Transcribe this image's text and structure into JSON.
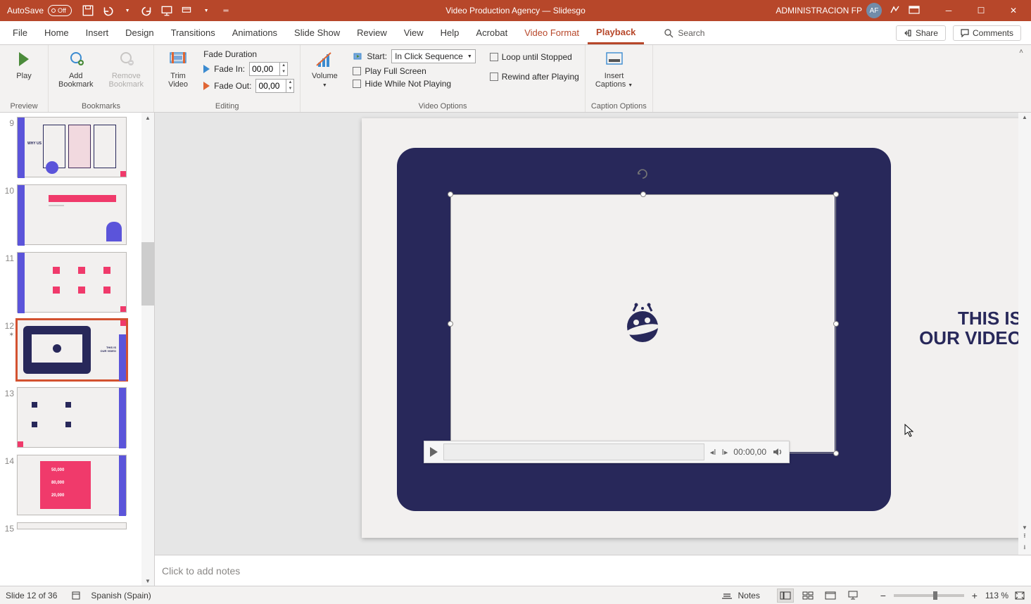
{
  "titlebar": {
    "autosave_label": "AutoSave",
    "autosave_state": "Off",
    "doc_title": "Video Production Agency — Slidesgo",
    "user_name": "ADMINISTRACION FP",
    "user_initials": "AF"
  },
  "tabs": {
    "file": "File",
    "home": "Home",
    "insert": "Insert",
    "design": "Design",
    "transitions": "Transitions",
    "animations": "Animations",
    "slideshow": "Slide Show",
    "review": "Review",
    "view": "View",
    "help": "Help",
    "acrobat": "Acrobat",
    "video_format": "Video Format",
    "playback": "Playback",
    "search": "Search",
    "share": "Share",
    "comments": "Comments"
  },
  "ribbon": {
    "preview": {
      "play": "Play",
      "group": "Preview"
    },
    "bookmarks": {
      "add": "Add\nBookmark",
      "remove": "Remove\nBookmark",
      "group": "Bookmarks"
    },
    "editing": {
      "trim": "Trim\nVideo",
      "fade_duration": "Fade Duration",
      "fade_in_label": "Fade In:",
      "fade_in_value": "00,00",
      "fade_out_label": "Fade Out:",
      "fade_out_value": "00,00",
      "group": "Editing"
    },
    "video_options": {
      "volume": "Volume",
      "start_label": "Start:",
      "start_value": "In Click Sequence",
      "play_fullscreen": "Play Full Screen",
      "hide_not_playing": "Hide While Not Playing",
      "loop": "Loop until Stopped",
      "rewind": "Rewind after Playing",
      "group": "Video Options"
    },
    "caption_options": {
      "insert_captions": "Insert\nCaptions",
      "group": "Caption Options"
    }
  },
  "thumbs": {
    "numbers": [
      "9",
      "10",
      "11",
      "12",
      "13",
      "14",
      "15"
    ],
    "active_index": 3
  },
  "slide": {
    "title_line1": "THIS IS",
    "title_line2": "OUR VIDEO",
    "video_time": "00:00,00"
  },
  "notes": {
    "placeholder": "Click to add notes"
  },
  "status": {
    "slide_info": "Slide 12 of 36",
    "language": "Spanish (Spain)",
    "notes_btn": "Notes",
    "zoom": "113 %"
  }
}
